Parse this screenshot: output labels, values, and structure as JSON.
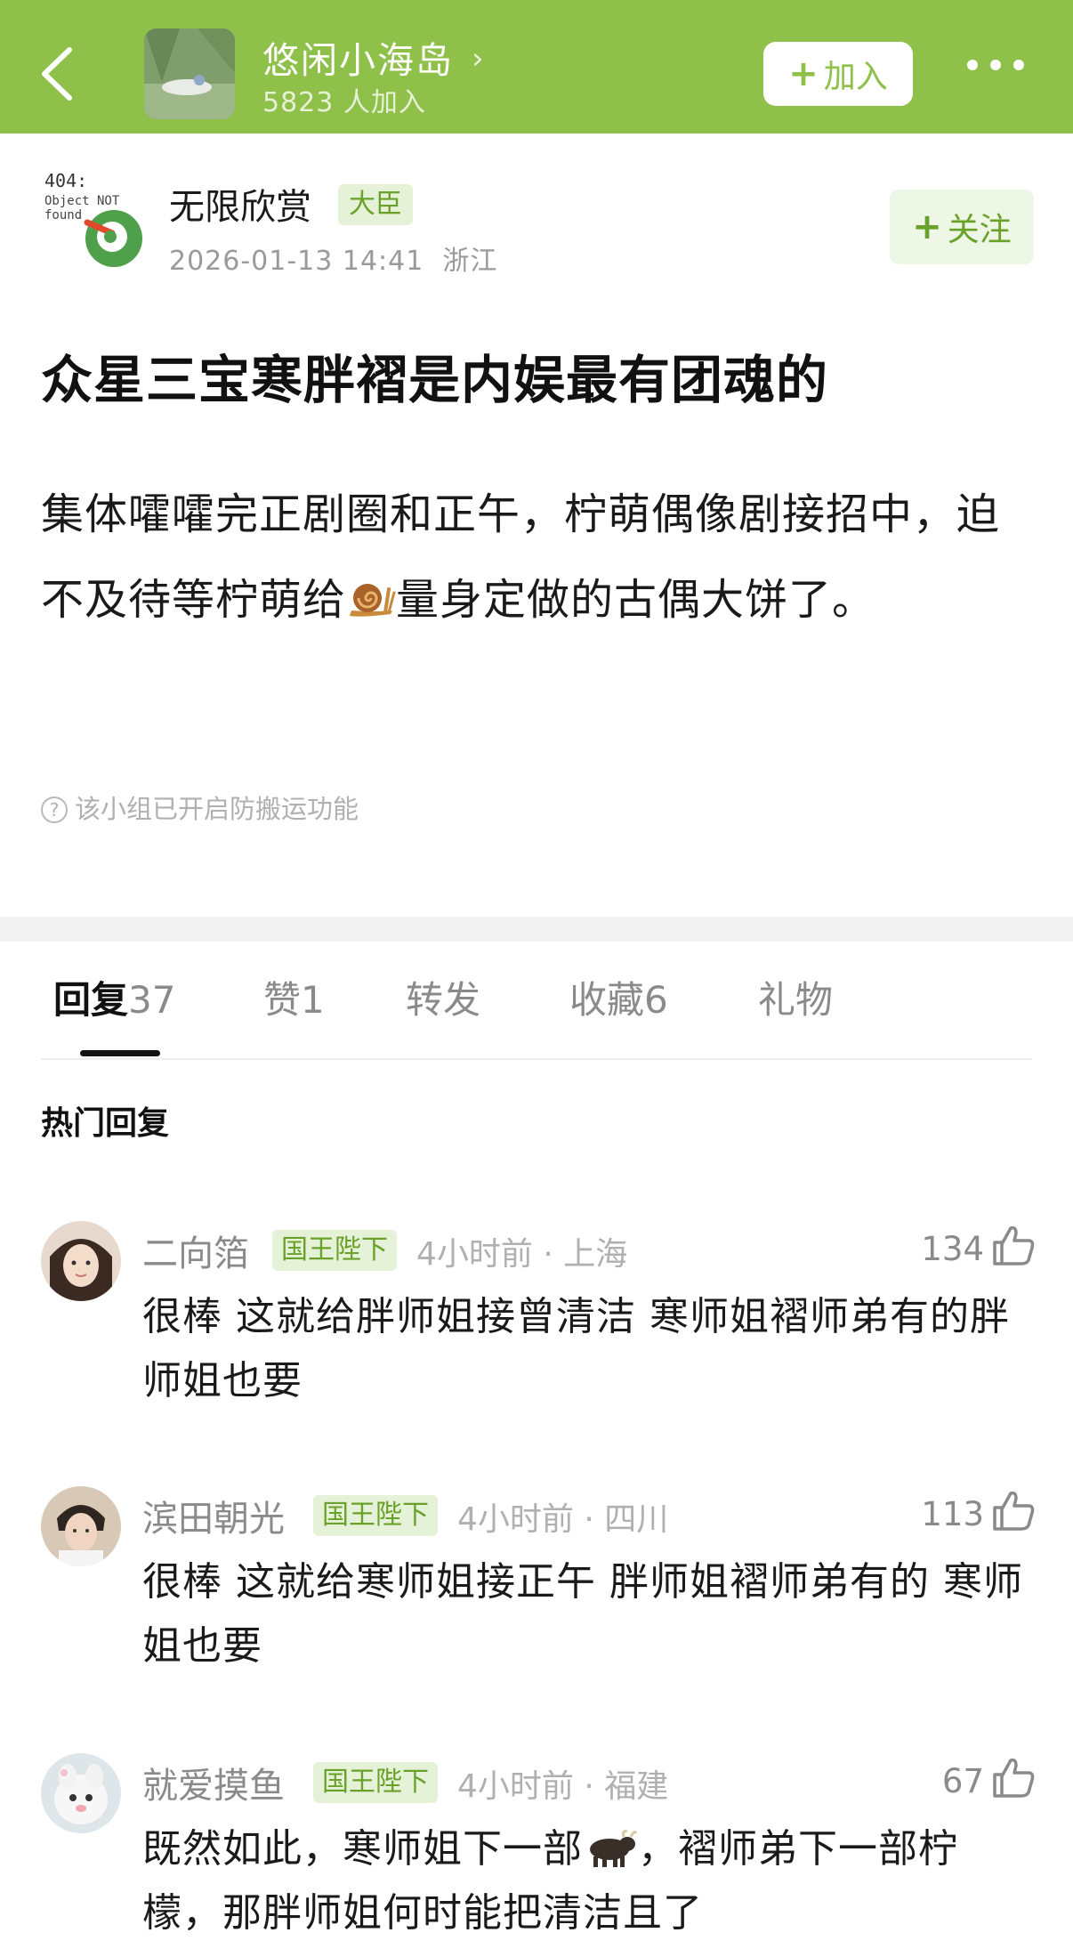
{
  "header": {
    "group_name": "悠闲小海岛",
    "member_count": "5823 人加入",
    "join_label": "加入",
    "join_plus": "+"
  },
  "post": {
    "author": "无限欣赏",
    "author_rank": "大臣",
    "timestamp": "2026-01-13 14:41",
    "location": "浙江",
    "follow_plus": "+",
    "follow_label": "关注",
    "title": "众星三宝寒胖褶是内娱最有团魂的",
    "body_part1": "集体嚯嚯完正剧圈和正午，柠萌偶像剧接招中，迫不及待等柠萌给",
    "body_part2": "量身定做的古偶大饼了。",
    "notice": "该小组已开启防搬运功能"
  },
  "tabs": [
    {
      "label": "回复",
      "count": "37"
    },
    {
      "label": "赞",
      "count": "1"
    },
    {
      "label": "转发",
      "count": ""
    },
    {
      "label": "收藏",
      "count": "6"
    },
    {
      "label": "礼物",
      "count": ""
    }
  ],
  "hot_replies_title": "热门回复",
  "comments": [
    {
      "name": "二向箔",
      "badge": "国王陛下",
      "meta": "4小时前 · 上海",
      "likes": "134",
      "text": "很棒 这就给胖师姐接曾清洁 寒师姐褶师弟有的胖师姐也要"
    },
    {
      "name": "滨田朝光",
      "badge": "国王陛下",
      "meta": "4小时前 · 四川",
      "likes": "113",
      "text": "很棒 这就给寒师姐接正午 胖师姐褶师弟有的 寒师姐也要"
    },
    {
      "name": "就爱摸鱼",
      "badge": "国王陛下",
      "meta": "4小时前 · 福建",
      "likes": "67",
      "text_part1": "既然如此，寒师姐下一部",
      "text_part2": "，褶师弟下一部柠檬，那胖师姐何时能把清洁且了"
    }
  ],
  "avatar_text": {
    "line1": "404:",
    "line2": "Object NOT",
    "line3": "found"
  },
  "colors": {
    "brand_green": "#8fc04a",
    "badge_green": "#6aa12a",
    "badge_bg": "#e6f2d8"
  }
}
